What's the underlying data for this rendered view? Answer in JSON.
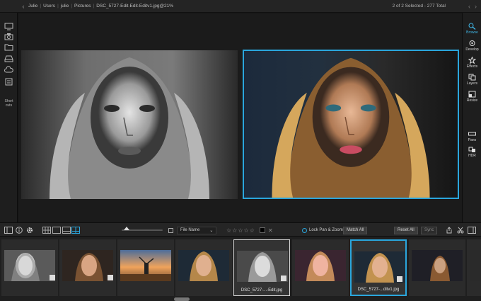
{
  "topbar": {
    "breadcrumbs": [
      "Julie",
      "Users",
      "julie",
      "Pictures",
      "DSC_5727-Edit-Edit-Editv1.jpg@21%"
    ],
    "status": "2 of 2 Selected - 277 Total"
  },
  "left_toolbar": {
    "items": [
      "computer-icon",
      "camera-icon",
      "folder-icon",
      "drive-icon",
      "cloud-icon",
      "shortcuts-icon"
    ],
    "shortcuts_label": "Short cuts"
  },
  "right_toolbar": {
    "items": [
      {
        "label": "Browse",
        "icon": "browse-icon",
        "active": true
      },
      {
        "label": "Develop",
        "icon": "develop-icon",
        "active": false
      },
      {
        "label": "Effects",
        "icon": "effects-icon",
        "active": false
      },
      {
        "label": "Layers",
        "icon": "layers-icon",
        "active": false
      },
      {
        "label": "Resize",
        "icon": "resize-icon",
        "active": false
      },
      {
        "label": "Pano",
        "icon": "pano-icon",
        "active": false
      },
      {
        "label": "HDR",
        "icon": "hdr-icon",
        "active": false
      }
    ]
  },
  "controls": {
    "sort_label": "File Name",
    "lock_label": "Lock Pan & Zoom",
    "match_label": "Match All",
    "reset_label": "Reset All",
    "sync_label": "Sync",
    "stars": [
      "☆",
      "☆",
      "☆",
      "☆",
      "☆"
    ]
  },
  "filmstrip": {
    "thumbs": [
      {
        "caption": "",
        "tone": "bw",
        "selected": "none"
      },
      {
        "caption": "",
        "tone": "warm",
        "selected": "none"
      },
      {
        "caption": "",
        "tone": "sunset",
        "selected": "none"
      },
      {
        "caption": "",
        "tone": "warm",
        "selected": "none"
      },
      {
        "caption": "DSC_5727-...-Edit.jpg",
        "tone": "bw",
        "selected": "white"
      },
      {
        "caption": "",
        "tone": "pink",
        "selected": "none"
      },
      {
        "caption": "DSC_5727-...ditv1.jpg",
        "tone": "warm",
        "selected": "blue"
      },
      {
        "caption": "",
        "tone": "dark",
        "selected": "none"
      }
    ]
  },
  "colors": {
    "accent": "#2aa6dd",
    "background": "#151515"
  }
}
